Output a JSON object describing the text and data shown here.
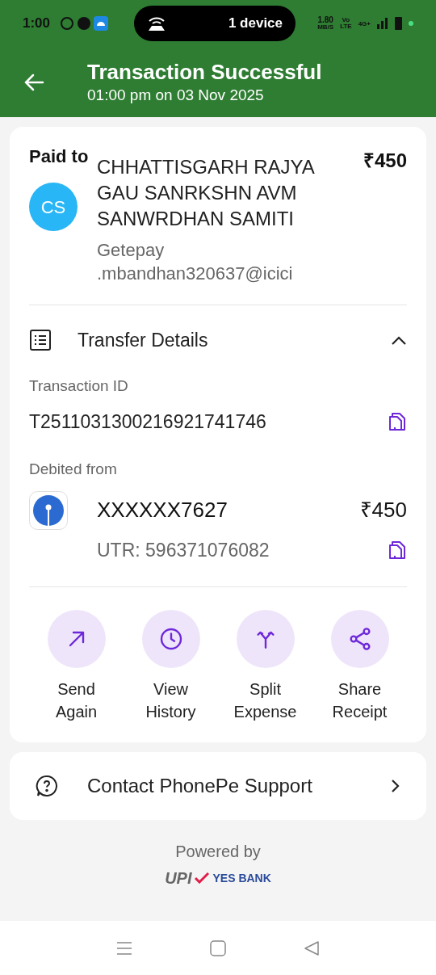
{
  "status_bar": {
    "time": "1:00",
    "pill_text": "1 device",
    "speed": "1.80",
    "speed_unit": "MB/S",
    "volte_top": "Vo",
    "volte_bottom": "LTE",
    "network": "4G+"
  },
  "header": {
    "title": "Transaction Successful",
    "subtitle": "01:00 pm on 03 Nov 2025"
  },
  "payee": {
    "label": "Paid to",
    "initials": "CS",
    "name": "CHHATTISGARH RAJYA GAU SANRKSHN AVM SANWRDHAN SAMITI",
    "amount": "₹450",
    "upi_id": "Getepay .mbandhan320637@icici"
  },
  "transfer_details": {
    "title": "Transfer Details",
    "expanded": true,
    "transaction_id_label": "Transaction ID",
    "transaction_id": "T2511031300216921741746",
    "debited_label": "Debited from",
    "account": "XXXXXX7627",
    "account_amount": "₹450",
    "utr": "UTR: 596371076082"
  },
  "actions": [
    {
      "kind": "send",
      "line1": "Send",
      "line2": "Again"
    },
    {
      "kind": "history",
      "line1": "View",
      "line2": "History"
    },
    {
      "kind": "split",
      "line1": "Split",
      "line2": "Expense"
    },
    {
      "kind": "share",
      "line1": "Share",
      "line2": "Receipt"
    }
  ],
  "support": {
    "label": "Contact PhonePe Support"
  },
  "footer": {
    "powered_by": "Powered by",
    "upi": "UPI",
    "bank": "YES BANK"
  }
}
